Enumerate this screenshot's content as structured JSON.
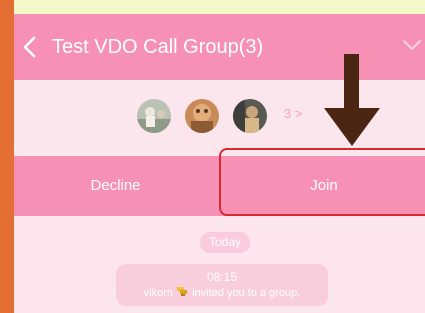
{
  "header": {
    "title": "Test VDO Call Group(3)"
  },
  "participants": {
    "count_label": "3 >",
    "avatars": [
      {
        "name": "avatar-1"
      },
      {
        "name": "avatar-2"
      },
      {
        "name": "avatar-3"
      }
    ]
  },
  "actions": {
    "decline_label": "Decline",
    "join_label": "Join"
  },
  "chat": {
    "date_label": "Today",
    "system_message": {
      "time": "08:15",
      "user": "vikorn",
      "text": "invited you to a group."
    }
  },
  "colors": {
    "header_pink": "#f690b4",
    "background_pink": "#fce5ec",
    "highlight_red": "#d72a2f",
    "arrow_brown": "#4a2512",
    "frame_orange": "#e36f35"
  },
  "icons": {
    "back": "back-icon",
    "collapse": "chevron-down-icon",
    "pointer": "down-arrow-icon",
    "user_badge": "emoji-icon"
  }
}
